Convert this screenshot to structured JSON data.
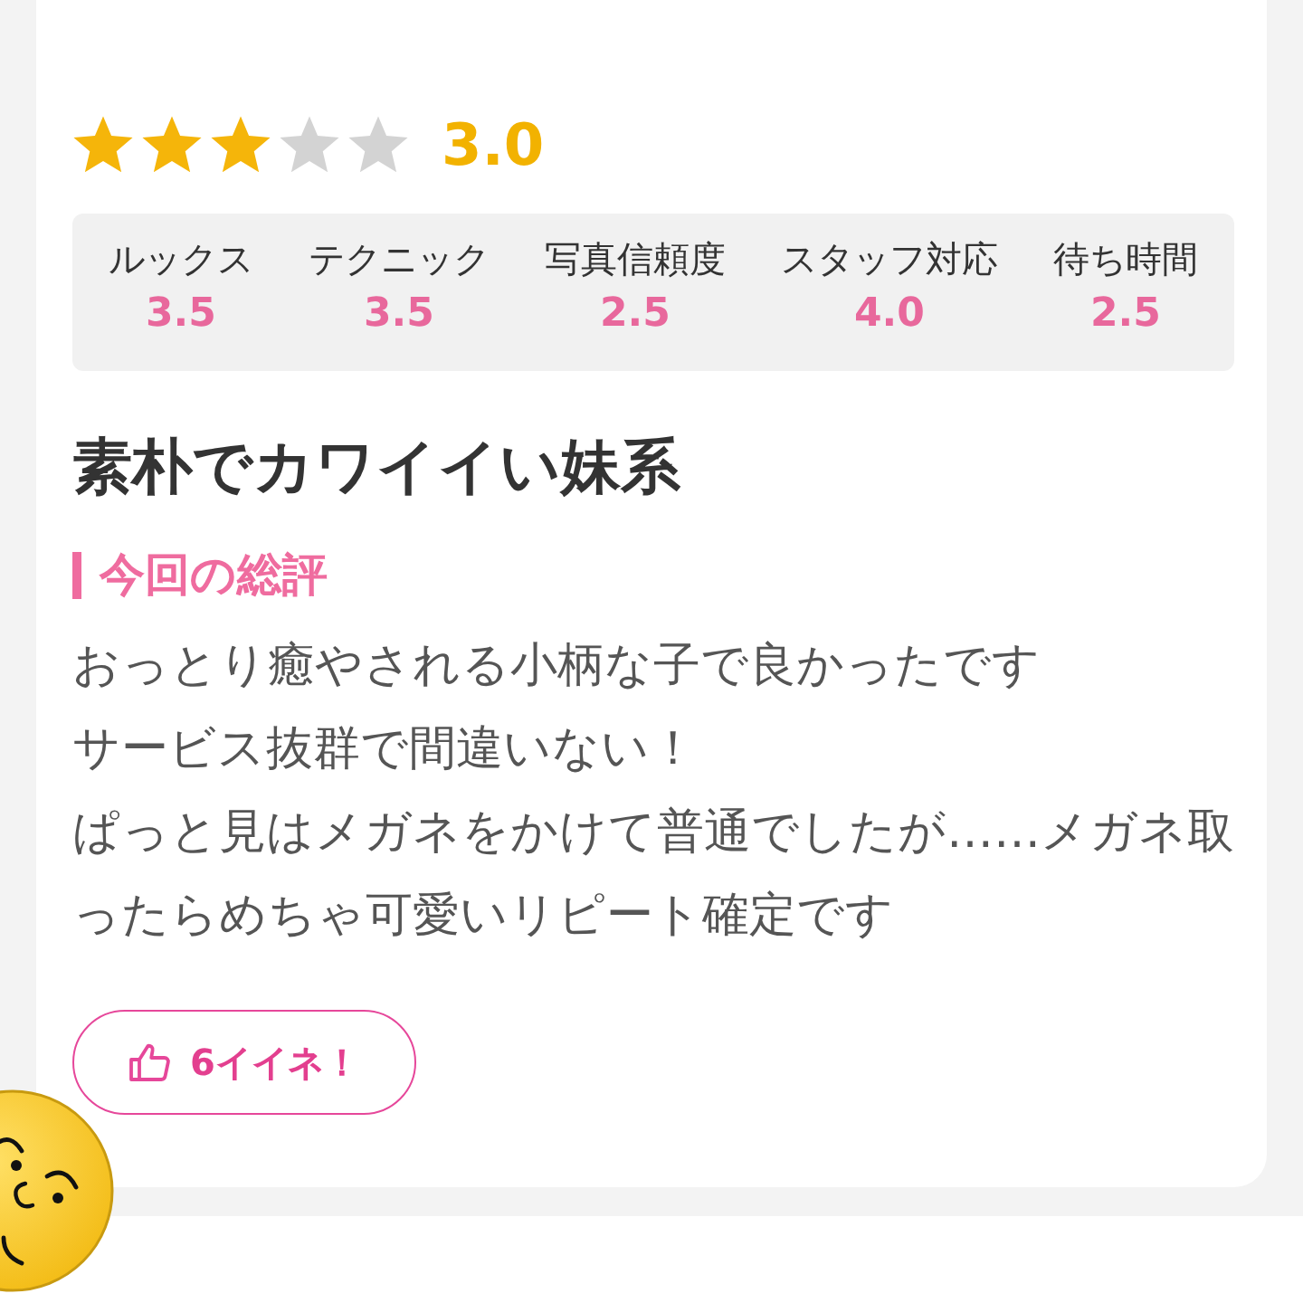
{
  "rating": {
    "stars": 3,
    "score": "3.0"
  },
  "scores": [
    {
      "label": "ルックス",
      "value": "3.5"
    },
    {
      "label": "テクニック",
      "value": "3.5"
    },
    {
      "label": "写真信頼度",
      "value": "2.5"
    },
    {
      "label": "スタッフ対応",
      "value": "4.0"
    },
    {
      "label": "待ち時間",
      "value": "2.5"
    }
  ],
  "title": "素朴でカワイイい妹系",
  "section_heading": "今回の総評",
  "review_lines": [
    "おっとり癒やされる小柄な子で良かったです",
    "サービス抜群で間違いない！",
    "ぱっと見はメガネをかけて普通でしたが……メガネ取",
    "ったらめちゃ可愛いリピート確定です"
  ],
  "like_button": {
    "label": "6イイネ！"
  }
}
